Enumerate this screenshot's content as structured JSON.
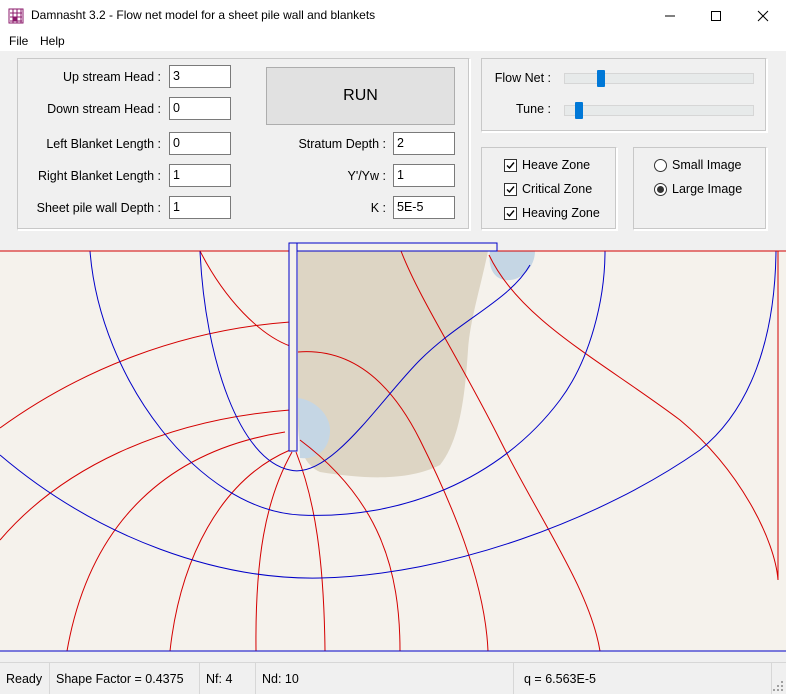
{
  "window": {
    "title": "Damnasht 3.2  -  Flow net model for a sheet pile wall and blankets",
    "minimize_icon": "minimize-icon",
    "maximize_icon": "maximize-icon",
    "close_icon": "close-icon"
  },
  "menu": [
    "File",
    "Help"
  ],
  "inputs": {
    "upstream_head": {
      "label": "Up stream Head :",
      "value": "3"
    },
    "downstream_head": {
      "label": "Down stream Head :",
      "value": "0"
    },
    "left_blanket": {
      "label": "Left Blanket Length :",
      "value": "0"
    },
    "right_blanket": {
      "label": "Right Blanket Length :",
      "value": "1"
    },
    "sheet_pile_depth": {
      "label": "Sheet pile wall Depth :",
      "value": "1"
    },
    "stratum_depth": {
      "label": "Stratum Depth :",
      "value": "2"
    },
    "gamma_ratio": {
      "label": "Y'/Yw :",
      "value": "1"
    },
    "k": {
      "label": "K :",
      "value": "5E-5"
    }
  },
  "run_label": "RUN",
  "sliders": {
    "flow_net": {
      "label": "Flow Net :",
      "level": 0.05
    },
    "tune": {
      "label": "Tune :",
      "level": 0.05
    }
  },
  "zones": [
    {
      "label": "Heave Zone",
      "checked": true
    },
    {
      "label": "Critical Zone",
      "checked": true
    },
    {
      "label": "Heaving Zone",
      "checked": true
    }
  ],
  "image_size": [
    {
      "label": "Small Image",
      "selected": false
    },
    {
      "label": "Large Image",
      "selected": true
    }
  ],
  "colors": {
    "equipotential": "#d40000",
    "flowline": "#0000c8",
    "heave_zone": "#ddd5c4",
    "critical_zone": "#c5d6e4",
    "soil": "#f5f2ec"
  },
  "status": {
    "ready": "Ready",
    "shape_factor": "Shape Factor = 0.4375",
    "nf": "Nf: 4",
    "nd": "Nd: 10",
    "q": "q = 6.563E-5"
  }
}
